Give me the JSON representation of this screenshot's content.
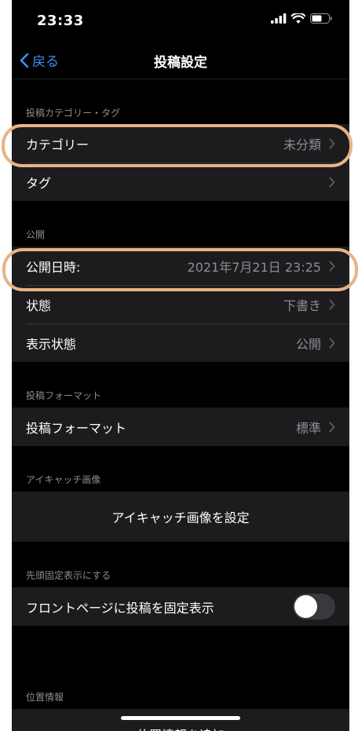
{
  "status_bar": {
    "time": "23:33"
  },
  "nav": {
    "back_label": "戻る",
    "title": "投稿設定"
  },
  "sections": {
    "category_tags": {
      "header": "投稿カテゴリー・タグ",
      "category_label": "カテゴリー",
      "category_value": "未分類",
      "tags_label": "タグ"
    },
    "publish": {
      "header": "公開",
      "datetime_label": "公開日時:",
      "datetime_value": "2021年7月21日 23:25",
      "status_label": "状態",
      "status_value": "下書き",
      "visibility_label": "表示状態",
      "visibility_value": "公開"
    },
    "format": {
      "header": "投稿フォーマット",
      "format_label": "投稿フォーマット",
      "format_value": "標準"
    },
    "featured_image": {
      "header": "アイキャッチ画像",
      "set_label": "アイキャッチ画像を設定"
    },
    "sticky": {
      "header": "先頭固定表示にする",
      "toggle_label": "フロントページに投稿を固定表示",
      "toggle_on": false
    },
    "location": {
      "header": "位置情報",
      "add_label": "位置情報を追加"
    }
  },
  "colors": {
    "accent": "#3e8ff7",
    "highlight": "#e8b485",
    "background": "#000000",
    "cell": "#1c1c1e",
    "secondary_text": "#8d8d92"
  }
}
